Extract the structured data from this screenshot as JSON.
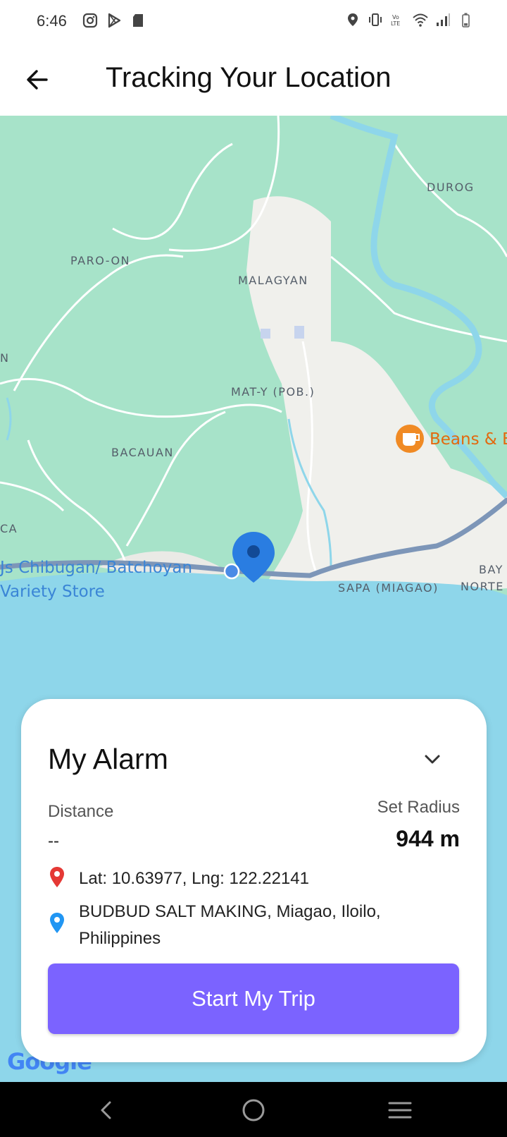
{
  "status_bar": {
    "time": "6:46",
    "left_icons": [
      "instagram-icon",
      "play-store-icon",
      "sd-card-icon"
    ],
    "right_icons": [
      "location-icon",
      "vibrate-icon",
      "volte-icon",
      "wifi-icon",
      "signal-icon",
      "battery-icon"
    ]
  },
  "app_bar": {
    "title": "Tracking Your Location",
    "back_icon": "arrow-back-icon"
  },
  "map": {
    "labels": {
      "durog": "DUROG",
      "paro_on": "PARO-ON",
      "malagyan": "MALAGYAN",
      "n_edge": "N",
      "mat_y": "MAT-Y (POB.)",
      "bacauan": "BACAUAN",
      "ca_edge": "CA",
      "bay": "BAY",
      "norte": "NORTE",
      "sapa": "SAPA (MIAGAO)"
    },
    "pois": {
      "chibugan_line1": "Js Chibugan/ Batchoyan",
      "chibugan_line2": "Variety Store",
      "beans": "Beans & B"
    },
    "attribution": "Google",
    "colors": {
      "land": "#a7e3c9",
      "water": "#8ed6ea",
      "road": "#ffffff",
      "urban": "#f0f0ec",
      "route": "#7d96b8",
      "pin": "#2a7de1"
    }
  },
  "alarm_card": {
    "title": "My Alarm",
    "distance_label": "Distance",
    "distance_value": "--",
    "radius_label": "Set Radius",
    "radius_value": "944 m",
    "coordinates": "Lat: 10.63977, Lng: 122.22141",
    "address": "BUDBUD SALT MAKING, Miagao, Iloilo, Philippines",
    "button_label": "Start My Trip",
    "button_color": "#7b63ff"
  },
  "nav_bar": {
    "icons": [
      "nav-back-icon",
      "nav-home-icon",
      "nav-recents-icon"
    ]
  }
}
